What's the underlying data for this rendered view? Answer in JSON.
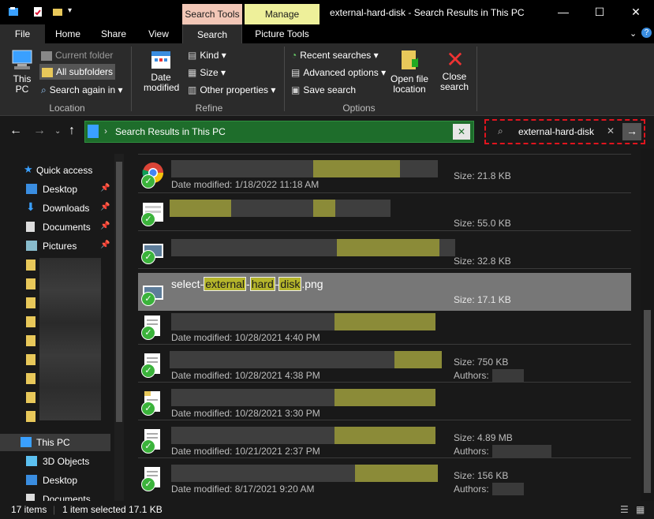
{
  "window": {
    "title": "external-hard-disk - Search Results in This PC",
    "context_tabs": [
      "Search Tools",
      "Manage"
    ],
    "controls": [
      "minimize",
      "maximize",
      "close"
    ]
  },
  "ribbon_tabs": [
    "File",
    "Home",
    "Share",
    "View",
    "Search",
    "Picture Tools"
  ],
  "active_tab": "Search",
  "ribbon": {
    "location": {
      "label": "Location",
      "this_pc": "This PC",
      "current_folder": "Current folder",
      "all_subfolders": "All subfolders",
      "search_again": "Search again in"
    },
    "refine": {
      "label": "Refine",
      "date_modified": "Date modified",
      "kind": "Kind",
      "size": "Size",
      "other_properties": "Other properties"
    },
    "options": {
      "label": "Options",
      "recent_searches": "Recent searches",
      "advanced_options": "Advanced options",
      "save_search": "Save search",
      "open_file_location": "Open file location",
      "close_search": "Close search"
    }
  },
  "address": {
    "path": "Search Results in This PC",
    "search_query": "external-hard-disk"
  },
  "nav_pane": {
    "quick_access": "Quick access",
    "pinned": [
      "Desktop",
      "Downloads",
      "Documents",
      "Pictures"
    ],
    "this_pc": "This PC",
    "this_pc_items": [
      "3D Objects",
      "Desktop",
      "Documents"
    ]
  },
  "results": {
    "selected_name_parts": [
      "select-",
      "external",
      "-",
      "hard",
      "-",
      "disk",
      ".png"
    ],
    "rows": [
      {
        "date": "Date modified: 1/18/2022 11:18 AM",
        "size": "Size: 21.8 KB",
        "authors": ""
      },
      {
        "date": "",
        "size": "Size: 55.0 KB",
        "authors": ""
      },
      {
        "date": "",
        "size": "Size: 32.8 KB",
        "authors": ""
      },
      {
        "date": "",
        "size": "Size: 17.1 KB",
        "authors": ""
      },
      {
        "date": "Date modified: 10/28/2021 4:40 PM",
        "size": "",
        "authors": ""
      },
      {
        "date": "Date modified: 10/28/2021 4:38 PM",
        "size": "Size: 750 KB",
        "authors": "Authors:"
      },
      {
        "date": "Date modified: 10/28/2021 3:30 PM",
        "size": "",
        "authors": ""
      },
      {
        "date": "Date modified: 10/21/2021 2:37 PM",
        "size": "Size: 4.89 MB",
        "authors": "Authors:"
      },
      {
        "date": "Date modified: 8/17/2021 9:20 AM",
        "size": "Size: 156 KB",
        "authors": "Authors:"
      }
    ]
  },
  "status": {
    "count": "17 items",
    "selection": "1 item selected  17.1 KB"
  },
  "colors": {
    "highlight": "#b5b52b",
    "search_tools_tab": "#f2c7b7",
    "manage_tab": "#eef09a",
    "address_bg": "#1e6d2b",
    "search_border": "#e0141e"
  }
}
